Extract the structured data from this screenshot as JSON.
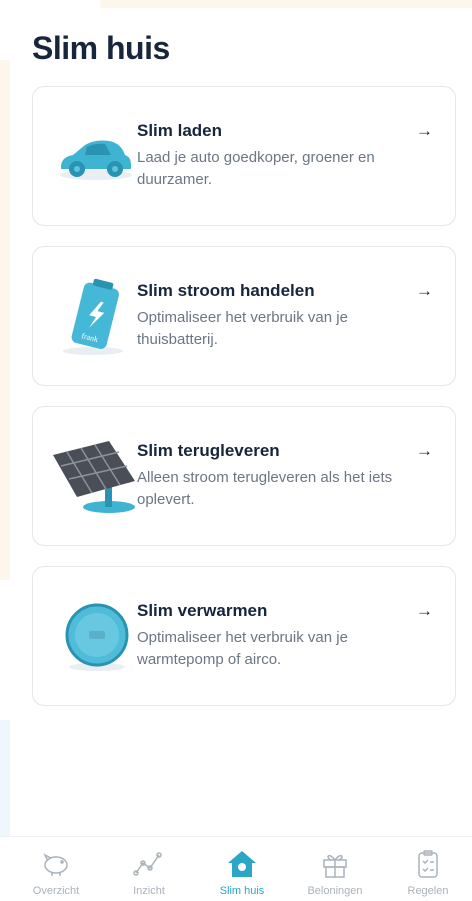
{
  "page": {
    "title": "Slim huis"
  },
  "cards": [
    {
      "title": "Slim laden",
      "desc": "Laad je auto goedkoper, groener en duurzamer.",
      "arrow": "→",
      "illustration": "car-icon"
    },
    {
      "title": "Slim stroom handelen",
      "desc": "Optimaliseer het verbruik van je thuisbatterij.",
      "arrow": "→",
      "illustration": "battery-icon",
      "illustration_text": "frank"
    },
    {
      "title": "Slim terugleveren",
      "desc": "Alleen stroom terugleveren als het iets oplevert.",
      "arrow": "→",
      "illustration": "solar-panel-icon"
    },
    {
      "title": "Slim verwarmen",
      "desc": "Optimaliseer het verbruik van je warmtepomp of airco.",
      "arrow": "→",
      "illustration": "thermostat-icon"
    }
  ],
  "nav": [
    {
      "label": "Overzicht",
      "icon": "piggy-bank-icon",
      "active": false
    },
    {
      "label": "Inzicht",
      "icon": "chart-line-icon",
      "active": false
    },
    {
      "label": "Slim huis",
      "icon": "house-icon",
      "active": true
    },
    {
      "label": "Beloningen",
      "icon": "gift-icon",
      "active": false
    },
    {
      "label": "Regelen",
      "icon": "clipboard-icon",
      "active": false
    }
  ],
  "colors": {
    "accent": "#2ba6c7",
    "title": "#17263d",
    "muted": "#6c7684",
    "nav_inactive": "#aab2bc"
  }
}
